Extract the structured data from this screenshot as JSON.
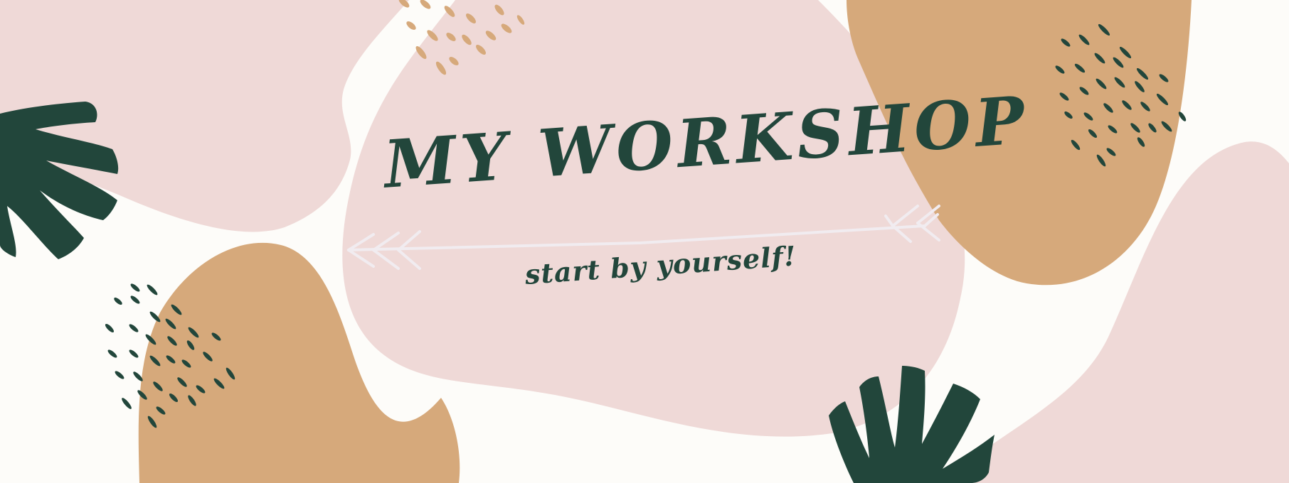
{
  "banner": {
    "title": "MY WORKSHOP",
    "subtitle": "start by yourself!"
  },
  "colors": {
    "background": "#fdfcf9",
    "blush": "#efd9d7",
    "tan": "#d6a97b",
    "dark_green": "#22463b",
    "arrow": "#f1ecf0"
  },
  "icons": [
    "leaf-icon",
    "arrow-icon",
    "dash-pattern-icon"
  ]
}
